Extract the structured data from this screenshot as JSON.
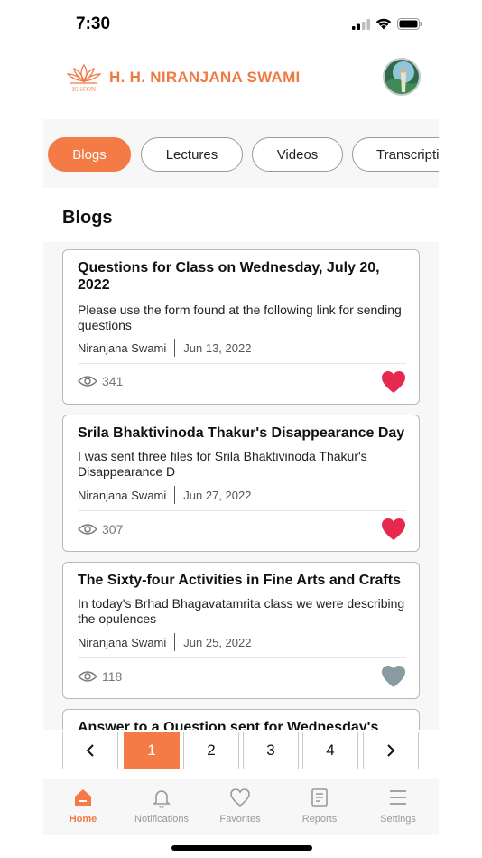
{
  "status_bar": {
    "time": "7:30"
  },
  "header": {
    "logo_text": "ISKCON",
    "title": "H. H. NIRANJANA SWAMI",
    "brand_color": "#f07a44"
  },
  "tabs": [
    {
      "label": "Blogs",
      "active": true
    },
    {
      "label": "Lectures",
      "active": false
    },
    {
      "label": "Videos",
      "active": false
    },
    {
      "label": "Transcriptions",
      "active": false
    }
  ],
  "section_title": "Blogs",
  "posts": [
    {
      "title": "Questions for Class on Wednesday, July 20, 2022",
      "excerpt": "Please use the form found at the following link for sending questions",
      "author": "Niranjana Swami",
      "date": "Jun 13, 2022",
      "views": "341",
      "favorited": true
    },
    {
      "title": "Srila Bhaktivinoda Thakur's Disappearance Day",
      "excerpt": "I was sent three files for Srila Bhaktivinoda Thakur's Disappearance D",
      "author": "Niranjana Swami",
      "date": "Jun 27, 2022",
      "views": "307",
      "favorited": true
    },
    {
      "title": "The Sixty-four Activities in Fine Arts and Crafts",
      "excerpt": "In today's Brhad Bhagavatamrita class we were describing the opulences",
      "author": "Niranjana Swami",
      "date": "Jun 25, 2022",
      "views": "118",
      "favorited": false
    },
    {
      "title": "Answer to a Question sent for Wednesday's"
    }
  ],
  "pagination": {
    "prev": "‹",
    "next": "›",
    "pages": [
      "1",
      "2",
      "3",
      "4"
    ],
    "current": "1"
  },
  "tab_bar": [
    {
      "label": "Home",
      "icon": "home-icon",
      "active": true
    },
    {
      "label": "Notifications",
      "icon": "bell-icon",
      "active": false
    },
    {
      "label": "Favorites",
      "icon": "heart-outline-icon",
      "active": false
    },
    {
      "label": "Reports",
      "icon": "document-icon",
      "active": false
    },
    {
      "label": "Settings",
      "icon": "menu-icon",
      "active": false
    }
  ],
  "colors": {
    "accent": "#f47a46",
    "heart_active": "#e8294f",
    "heart_inactive": "#8a9aa3"
  }
}
